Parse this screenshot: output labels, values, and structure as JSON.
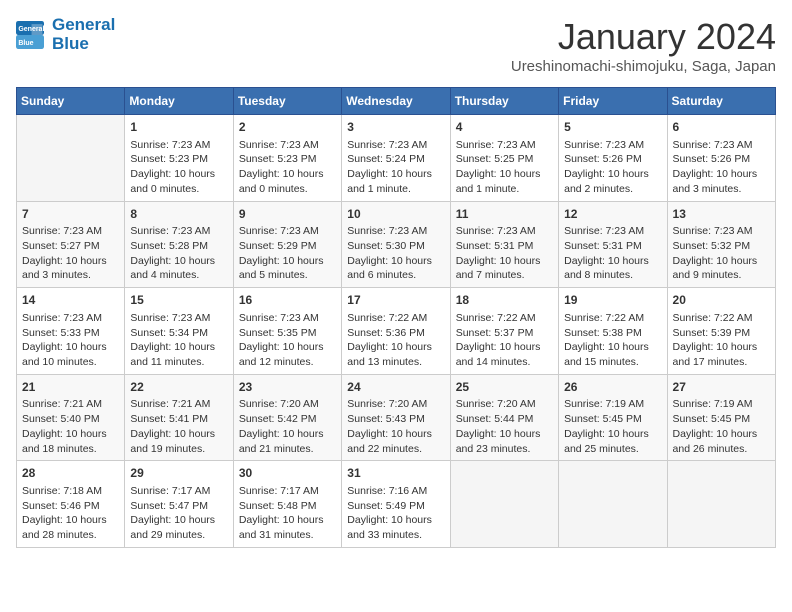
{
  "logo": {
    "line1": "General",
    "line2": "Blue"
  },
  "title": "January 2024",
  "subtitle": "Ureshinomachi-shimojuku, Saga, Japan",
  "days_of_week": [
    "Sunday",
    "Monday",
    "Tuesday",
    "Wednesday",
    "Thursday",
    "Friday",
    "Saturday"
  ],
  "weeks": [
    [
      {
        "day": "",
        "data": ""
      },
      {
        "day": "1",
        "data": "Sunrise: 7:23 AM\nSunset: 5:23 PM\nDaylight: 10 hours\nand 0 minutes."
      },
      {
        "day": "2",
        "data": "Sunrise: 7:23 AM\nSunset: 5:23 PM\nDaylight: 10 hours\nand 0 minutes."
      },
      {
        "day": "3",
        "data": "Sunrise: 7:23 AM\nSunset: 5:24 PM\nDaylight: 10 hours\nand 1 minute."
      },
      {
        "day": "4",
        "data": "Sunrise: 7:23 AM\nSunset: 5:25 PM\nDaylight: 10 hours\nand 1 minute."
      },
      {
        "day": "5",
        "data": "Sunrise: 7:23 AM\nSunset: 5:26 PM\nDaylight: 10 hours\nand 2 minutes."
      },
      {
        "day": "6",
        "data": "Sunrise: 7:23 AM\nSunset: 5:26 PM\nDaylight: 10 hours\nand 3 minutes."
      }
    ],
    [
      {
        "day": "7",
        "data": "Sunrise: 7:23 AM\nSunset: 5:27 PM\nDaylight: 10 hours\nand 3 minutes."
      },
      {
        "day": "8",
        "data": "Sunrise: 7:23 AM\nSunset: 5:28 PM\nDaylight: 10 hours\nand 4 minutes."
      },
      {
        "day": "9",
        "data": "Sunrise: 7:23 AM\nSunset: 5:29 PM\nDaylight: 10 hours\nand 5 minutes."
      },
      {
        "day": "10",
        "data": "Sunrise: 7:23 AM\nSunset: 5:30 PM\nDaylight: 10 hours\nand 6 minutes."
      },
      {
        "day": "11",
        "data": "Sunrise: 7:23 AM\nSunset: 5:31 PM\nDaylight: 10 hours\nand 7 minutes."
      },
      {
        "day": "12",
        "data": "Sunrise: 7:23 AM\nSunset: 5:31 PM\nDaylight: 10 hours\nand 8 minutes."
      },
      {
        "day": "13",
        "data": "Sunrise: 7:23 AM\nSunset: 5:32 PM\nDaylight: 10 hours\nand 9 minutes."
      }
    ],
    [
      {
        "day": "14",
        "data": "Sunrise: 7:23 AM\nSunset: 5:33 PM\nDaylight: 10 hours\nand 10 minutes."
      },
      {
        "day": "15",
        "data": "Sunrise: 7:23 AM\nSunset: 5:34 PM\nDaylight: 10 hours\nand 11 minutes."
      },
      {
        "day": "16",
        "data": "Sunrise: 7:23 AM\nSunset: 5:35 PM\nDaylight: 10 hours\nand 12 minutes."
      },
      {
        "day": "17",
        "data": "Sunrise: 7:22 AM\nSunset: 5:36 PM\nDaylight: 10 hours\nand 13 minutes."
      },
      {
        "day": "18",
        "data": "Sunrise: 7:22 AM\nSunset: 5:37 PM\nDaylight: 10 hours\nand 14 minutes."
      },
      {
        "day": "19",
        "data": "Sunrise: 7:22 AM\nSunset: 5:38 PM\nDaylight: 10 hours\nand 15 minutes."
      },
      {
        "day": "20",
        "data": "Sunrise: 7:22 AM\nSunset: 5:39 PM\nDaylight: 10 hours\nand 17 minutes."
      }
    ],
    [
      {
        "day": "21",
        "data": "Sunrise: 7:21 AM\nSunset: 5:40 PM\nDaylight: 10 hours\nand 18 minutes."
      },
      {
        "day": "22",
        "data": "Sunrise: 7:21 AM\nSunset: 5:41 PM\nDaylight: 10 hours\nand 19 minutes."
      },
      {
        "day": "23",
        "data": "Sunrise: 7:20 AM\nSunset: 5:42 PM\nDaylight: 10 hours\nand 21 minutes."
      },
      {
        "day": "24",
        "data": "Sunrise: 7:20 AM\nSunset: 5:43 PM\nDaylight: 10 hours\nand 22 minutes."
      },
      {
        "day": "25",
        "data": "Sunrise: 7:20 AM\nSunset: 5:44 PM\nDaylight: 10 hours\nand 23 minutes."
      },
      {
        "day": "26",
        "data": "Sunrise: 7:19 AM\nSunset: 5:45 PM\nDaylight: 10 hours\nand 25 minutes."
      },
      {
        "day": "27",
        "data": "Sunrise: 7:19 AM\nSunset: 5:45 PM\nDaylight: 10 hours\nand 26 minutes."
      }
    ],
    [
      {
        "day": "28",
        "data": "Sunrise: 7:18 AM\nSunset: 5:46 PM\nDaylight: 10 hours\nand 28 minutes."
      },
      {
        "day": "29",
        "data": "Sunrise: 7:17 AM\nSunset: 5:47 PM\nDaylight: 10 hours\nand 29 minutes."
      },
      {
        "day": "30",
        "data": "Sunrise: 7:17 AM\nSunset: 5:48 PM\nDaylight: 10 hours\nand 31 minutes."
      },
      {
        "day": "31",
        "data": "Sunrise: 7:16 AM\nSunset: 5:49 PM\nDaylight: 10 hours\nand 33 minutes."
      },
      {
        "day": "",
        "data": ""
      },
      {
        "day": "",
        "data": ""
      },
      {
        "day": "",
        "data": ""
      }
    ]
  ]
}
